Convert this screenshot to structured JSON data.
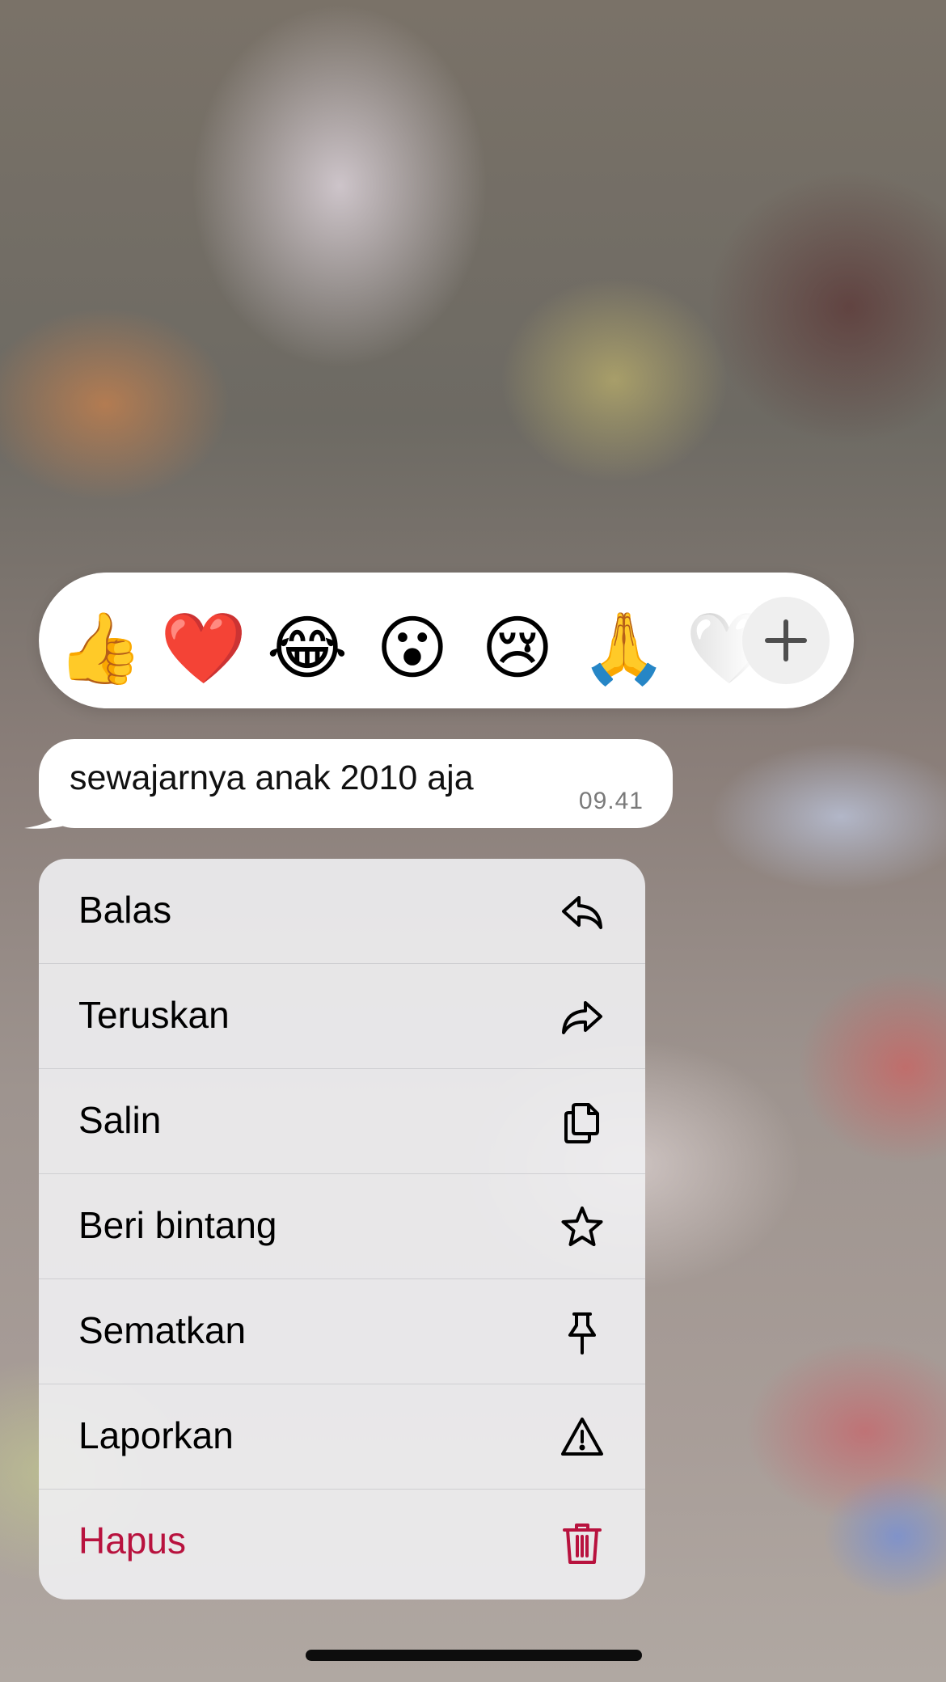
{
  "reactions": {
    "emojis": [
      {
        "name": "thumbs-up",
        "glyph": "👍"
      },
      {
        "name": "red-heart",
        "glyph": "❤️"
      },
      {
        "name": "face-with-tears-of-joy",
        "glyph": "😂"
      },
      {
        "name": "face-with-open-mouth",
        "glyph": "😮"
      },
      {
        "name": "crying-face",
        "glyph": "😢"
      },
      {
        "name": "folded-hands",
        "glyph": "🙏"
      },
      {
        "name": "white-heart",
        "glyph": "🤍"
      }
    ],
    "more_icon": "plus-icon"
  },
  "message": {
    "text": "sewajarnya anak 2010 aja",
    "time": "09.41"
  },
  "menu": {
    "items": [
      {
        "label": "Balas",
        "icon": "reply-icon"
      },
      {
        "label": "Teruskan",
        "icon": "forward-icon"
      },
      {
        "label": "Salin",
        "icon": "copy-icon"
      },
      {
        "label": "Beri bintang",
        "icon": "star-icon"
      },
      {
        "label": "Sematkan",
        "icon": "pin-icon"
      },
      {
        "label": "Laporkan",
        "icon": "warning-icon"
      },
      {
        "label": "Hapus",
        "icon": "trash-icon",
        "color": "#b8123e"
      }
    ]
  }
}
